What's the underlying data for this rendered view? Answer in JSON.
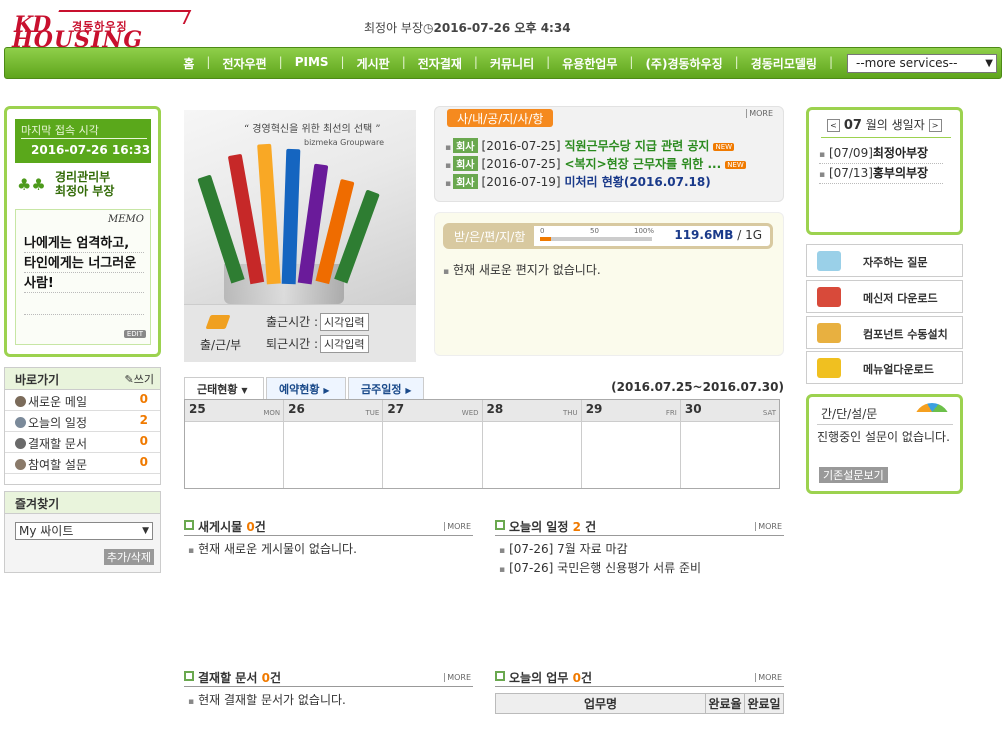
{
  "header": {
    "logo_top": "KD",
    "logo_korean": "경동하우징",
    "logo_bottom": "HOUSING",
    "user": "최정아 부장",
    "clock_icon": "clock-icon",
    "datetime": "2016-07-26 오후 4:34"
  },
  "nav": {
    "items": [
      "홈",
      "전자우편",
      "PIMS",
      "게시판",
      "전자결재",
      "커뮤니티",
      "유용한업무",
      "(주)경동하우징",
      "경동리모델링"
    ],
    "more_services": "--more services--"
  },
  "profile": {
    "last_login_label": "마지막 접속 시각",
    "last_login_date": "2016-07-26 16:33",
    "department": "경리관리부",
    "name": "최정아 부장",
    "memo_title": "MEMO",
    "memo_text": "나에게는 엄격하고, 타인에게는 너그러운 사람!",
    "edit_label": "EDIT"
  },
  "quick": {
    "title": "바로가기",
    "write_label": "쓰기",
    "items": [
      {
        "label": "새로운 메일",
        "count": "0",
        "color": "#7b6b5a"
      },
      {
        "label": "오늘의 일정",
        "count": "2",
        "color": "#7b8a9a"
      },
      {
        "label": "결재할 문서",
        "count": "0",
        "color": "#6a6a6a"
      },
      {
        "label": "참여할 설문",
        "count": "0",
        "color": "#8a7a6a"
      }
    ]
  },
  "favorites": {
    "title": "즐겨찾기",
    "selected": "My 싸이트",
    "add_delete": "추가/삭제"
  },
  "photo": {
    "quote": "“ 경영혁신을 위한 최선의 선택 ”",
    "brand": "bizmeka Groupware"
  },
  "attendance": {
    "label": "출/근/부",
    "clock_in_label": "출근시간 :",
    "clock_out_label": "퇴근시간 :",
    "input_button": "시각입력"
  },
  "notice": {
    "tab": "사/내/공/지/사/항",
    "more": "MORE",
    "items": [
      {
        "tag": "회사",
        "date": "[2016-07-25]",
        "title": "직원근무수당 지급 관련 공지",
        "new": "NEW",
        "style": "green"
      },
      {
        "tag": "회사",
        "date": "[2016-07-25]",
        "title": "<복지>현장 근무자를 위한 ...",
        "new": "NEW",
        "style": "green"
      },
      {
        "tag": "회사",
        "date": "[2016-07-19]",
        "title": "미처리 현황(2016.07.18)",
        "new": "",
        "style": "blue"
      }
    ]
  },
  "mail": {
    "label": "받/은/편/지/함",
    "ticks": [
      "0",
      "50",
      "100%"
    ],
    "usage_fraction": 0.1,
    "used": "119.6MB",
    "total": " / 1G",
    "message": "현재 새로운 편지가 없습니다."
  },
  "calendar": {
    "tabs": [
      "근태현황",
      "예약현황",
      "금주일정"
    ],
    "range": "(2016.07.25~2016.07.30)",
    "days": [
      {
        "num": "25",
        "dow": "MON"
      },
      {
        "num": "26",
        "dow": "TUE"
      },
      {
        "num": "27",
        "dow": "WED"
      },
      {
        "num": "28",
        "dow": "THU"
      },
      {
        "num": "29",
        "dow": "FRI"
      },
      {
        "num": "30",
        "dow": "SAT"
      }
    ]
  },
  "birthday": {
    "prev": "<",
    "month": "07",
    "label": "월의 생일자",
    "next": ">",
    "items": [
      {
        "date": "[07/09]",
        "name": "최정아부장"
      },
      {
        "date": "[07/13]",
        "name": "홍부의부장"
      }
    ]
  },
  "links": [
    {
      "label": "자주하는 질문",
      "color": "#9ad0e8"
    },
    {
      "label": "메신저 다운로드",
      "color": "#d84a3a"
    },
    {
      "label": "컴포넌트 수동설치",
      "color": "#e8b040"
    },
    {
      "label": "메뉴얼다운로드",
      "color": "#f0c020"
    }
  ],
  "survey": {
    "title": "간/단/설/문",
    "message": "진행중인 설문이 없습니다.",
    "button": "기존설문보기"
  },
  "boards": {
    "posts": {
      "title": "새게시물",
      "count": "0",
      "unit": "건",
      "more": "MORE",
      "empty": "현재 새로운 게시물이 없습니다."
    },
    "schedule": {
      "title": "오늘의 일정",
      "count": "2",
      "unit": " 건",
      "more": "MORE",
      "items": [
        "[07-26] 7월 자료 마감",
        "[07-26] 국민은행 신용평가 서류 준비"
      ]
    },
    "approval": {
      "title": "결재할 문서",
      "count": "0",
      "unit": "건",
      "more": "MORE",
      "empty": "현재 결재할 문서가 없습니다."
    },
    "work": {
      "title": "오늘의 업무",
      "count": "0",
      "unit": "건",
      "more": "MORE",
      "columns": [
        "업무명",
        "완료율",
        "완료일"
      ]
    }
  }
}
